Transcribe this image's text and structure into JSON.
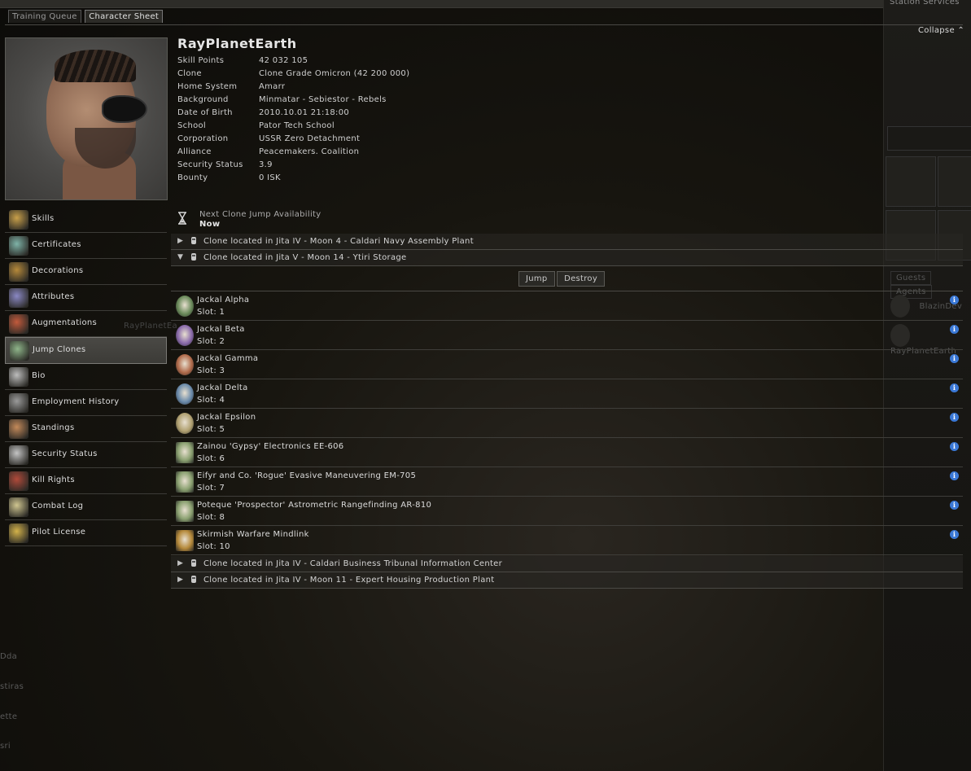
{
  "window": {
    "tabs": [
      {
        "label": "Training Queue"
      },
      {
        "label": "Character Sheet"
      }
    ],
    "collapse_label": "Collapse"
  },
  "background": {
    "station_services": "Station Services",
    "right_tabs": [
      "Guests",
      "Agents"
    ],
    "guests": [
      "BlazinDev",
      "RayPlanetEarth"
    ],
    "left_ghost_text": [
      "Dda",
      "stiras",
      "ette",
      "sri"
    ],
    "ghost_name": "RayPlanetEa"
  },
  "character": {
    "name": "RayPlanetEarth",
    "fields": [
      {
        "key": "Skill Points",
        "value": "42 032 105"
      },
      {
        "key": "Clone",
        "value": "Clone Grade Omicron (42 200 000)"
      },
      {
        "key": "Home System",
        "value": "Amarr"
      },
      {
        "key": "Background",
        "value": "Minmatar - Sebiestor - Rebels"
      },
      {
        "key": "Date of Birth",
        "value": "2010.10.01 21:18:00"
      },
      {
        "key": "School",
        "value": "Pator Tech School"
      },
      {
        "key": "Corporation",
        "value": "USSR Zero Detachment"
      },
      {
        "key": "Alliance",
        "value": "Peacemakers. Coalition"
      },
      {
        "key": "Security Status",
        "value": "3.9"
      },
      {
        "key": "Bounty",
        "value": "0 ISK"
      }
    ]
  },
  "menu": [
    {
      "label": "Skills",
      "icon": "skills-book-icon",
      "color": "#c9a04a"
    },
    {
      "label": "Certificates",
      "icon": "certificate-icon",
      "color": "#7fb3a8"
    },
    {
      "label": "Decorations",
      "icon": "medal-icon",
      "color": "#b5893a"
    },
    {
      "label": "Attributes",
      "icon": "attributes-icon",
      "color": "#8a88c4"
    },
    {
      "label": "Augmentations",
      "icon": "augmentations-icon",
      "color": "#c25a3c"
    },
    {
      "label": "Jump Clones",
      "icon": "jump-clone-icon",
      "color": "#8fb58a",
      "active": true
    },
    {
      "label": "Bio",
      "icon": "bio-document-icon",
      "color": "#bdbdbd"
    },
    {
      "label": "Employment History",
      "icon": "employment-icon",
      "color": "#9a9a9a"
    },
    {
      "label": "Standings",
      "icon": "standings-icon",
      "color": "#c48a5a"
    },
    {
      "label": "Security Status",
      "icon": "security-skull-icon",
      "color": "#c4c4c4"
    },
    {
      "label": "Kill Rights",
      "icon": "kill-rights-icon",
      "color": "#b04a3a"
    },
    {
      "label": "Combat Log",
      "icon": "combat-swords-icon",
      "color": "#d0c690"
    },
    {
      "label": "Pilot License",
      "icon": "pilot-license-icon",
      "color": "#d3b24a"
    }
  ],
  "next_jump": {
    "title": "Next Clone Jump Availability",
    "value": "Now"
  },
  "clones": {
    "collapsed_top": "Clone located in Jita IV - Moon 4 - Caldari Navy Assembly Plant",
    "expanded": "Clone located in Jita V - Moon 14 - Ytiri Storage",
    "collapsed_bottom": [
      "Clone located in Jita IV - Caldari Business Tribunal Information Center",
      "Clone located in Jita IV - Moon 11 - Expert Housing Production Plant"
    ],
    "buttons": {
      "jump": "Jump",
      "destroy": "Destroy"
    }
  },
  "implants": [
    {
      "name": "Jackal Alpha",
      "slot": "Slot: 1",
      "icon": "skull-implant-icon",
      "color": "#6a8a5a"
    },
    {
      "name": "Jackal Beta",
      "slot": "Slot: 2",
      "icon": "skull-implant-icon",
      "color": "#8a6aaa"
    },
    {
      "name": "Jackal Gamma",
      "slot": "Slot: 3",
      "icon": "skull-implant-icon",
      "color": "#b06a4a"
    },
    {
      "name": "Jackal Delta",
      "slot": "Slot: 4",
      "icon": "skull-implant-icon",
      "color": "#6a8aaa"
    },
    {
      "name": "Jackal Epsilon",
      "slot": "Slot: 5",
      "icon": "skull-implant-icon",
      "color": "#b0a070"
    },
    {
      "name": "Zainou 'Gypsy' Electronics EE-606",
      "slot": "Slot: 6",
      "icon": "hardwiring-implant-icon",
      "color": "#8aa070"
    },
    {
      "name": "Eifyr and Co. 'Rogue' Evasive Maneuvering EM-705",
      "slot": "Slot: 7",
      "icon": "hardwiring-implant-icon",
      "color": "#8aa070"
    },
    {
      "name": "Poteque 'Prospector' Astrometric Rangefinding AR-810",
      "slot": "Slot: 8",
      "icon": "hardwiring-implant-icon",
      "color": "#8aa070"
    },
    {
      "name": "Skirmish Warfare Mindlink",
      "slot": "Slot: 10",
      "icon": "mindlink-implant-icon",
      "color": "#b5893a"
    }
  ]
}
